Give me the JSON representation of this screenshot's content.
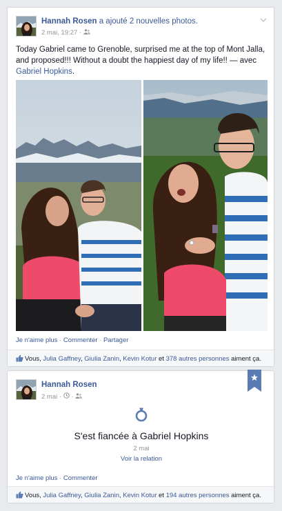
{
  "post1": {
    "author": "Hannah Rosen",
    "verb": "a ajouté 2 nouvelles photos.",
    "timestamp": "2 mai, 19:27",
    "audience_icon": "friends-icon",
    "text_main": "Today Gabriel came to Grenoble, surprised me at the top of Mont Jalla, and proposed!!! Without a doubt the happiest day of my life!! — avec ",
    "text_tag": "Gabriel Hopkins",
    "text_end": ".",
    "actions": {
      "unlike": "Je n'aime plus",
      "comment": "Commenter",
      "share": "Partager",
      "sep": " · "
    },
    "likes": {
      "you": "Vous, ",
      "p1": "Julia Gaffney",
      "c1": ", ",
      "p2": "Giulia Zanin",
      "c2": ", ",
      "p3": "Kevin Kotur",
      "and": " et ",
      "others": "378 autres personnes",
      "tail": " aiment ça."
    }
  },
  "post2": {
    "author": "Hannah Rosen",
    "timestamp": "2 mai",
    "audience_icon": "friends-icon",
    "event_icon": "ring-icon",
    "event_title": "S'est fiancée à Gabriel Hopkins",
    "event_date": "2 mai",
    "event_link": "Voir la relation",
    "actions": {
      "unlike": "Je n'aime plus",
      "comment": "Commenter",
      "sep": " · "
    },
    "likes": {
      "you": "Vous, ",
      "p1": "Julia Gaffney",
      "c1": ", ",
      "p2": "Giulia Zanin",
      "c2": ", ",
      "p3": "Kevin Kotur",
      "and": " et ",
      "others": "194 autres personnes",
      "tail": " aiment ça."
    }
  },
  "colors": {
    "link": "#3b5998",
    "meta": "#90949c",
    "ribbon": "#5b7bb4"
  }
}
